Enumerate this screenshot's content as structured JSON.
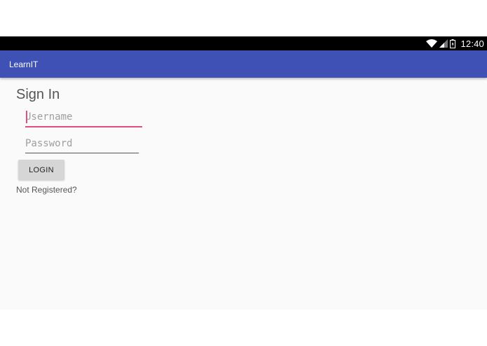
{
  "status_bar": {
    "time": "12:40",
    "icons": [
      "wifi-icon",
      "signal-icon",
      "battery-icon"
    ]
  },
  "app_bar": {
    "title": "LearnIT",
    "color": "#3f51b5"
  },
  "form": {
    "heading": "Sign In",
    "username": {
      "placeholder": "Username",
      "value": ""
    },
    "password": {
      "placeholder": "Password",
      "value": ""
    },
    "login_label": "LOGIN",
    "register_link": "Not Registered?"
  },
  "colors": {
    "accent": "#e04e86",
    "primary": "#3f51b5",
    "status_bar": "#000000",
    "background": "#fafafa"
  }
}
